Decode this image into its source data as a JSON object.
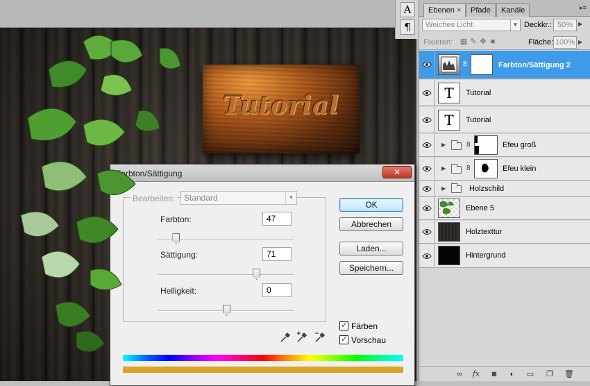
{
  "canvas": {
    "sign_text": "Tutorial"
  },
  "tool_strip": {
    "items": [
      {
        "name": "character-panel-icon",
        "glyph": "A"
      },
      {
        "name": "paragraph-panel-icon",
        "glyph": "¶"
      }
    ]
  },
  "layers_panel": {
    "tabs": [
      {
        "label": "Ebenen",
        "active": true,
        "close": "×"
      },
      {
        "label": "Pfade",
        "active": false
      },
      {
        "label": "Kanäle",
        "active": false
      }
    ],
    "menu_icon": "▸≡",
    "blend_mode": "Weiches Licht",
    "opacity_label": "Deckkr.:",
    "opacity_value": "50%",
    "lock_label": "Fixieren:",
    "fill_label": "Fläche:",
    "fill_value": "100%",
    "layers": [
      {
        "name": "Farbton/Sättigung 2",
        "selected": true,
        "type": "adjustment"
      },
      {
        "name": "Tutorial",
        "type": "text"
      },
      {
        "name": "Tutorial",
        "type": "text"
      },
      {
        "name": "Efeu groß",
        "type": "group-mask"
      },
      {
        "name": "Efeu klein",
        "type": "group-mask"
      },
      {
        "name": "Holzschild",
        "type": "group"
      },
      {
        "name": "Ebene 5",
        "type": "pixel"
      },
      {
        "name": "Holztexttur",
        "type": "pixel"
      },
      {
        "name": "Hintergrund",
        "type": "pixel"
      }
    ],
    "footer_icons": [
      "link-layers-icon",
      "fx-icon",
      "add-mask-icon",
      "adjustment-layer-icon",
      "new-group-icon",
      "new-layer-icon",
      "delete-layer-icon"
    ]
  },
  "dialog": {
    "title": "Farbton/Sättigung",
    "close_label": "✕",
    "edit_label": "Bearbeiten:",
    "edit_value": "Standard",
    "sliders": [
      {
        "label": "Farbton:",
        "value": "47",
        "position": 0.13
      },
      {
        "label": "Sättigung:",
        "value": "71",
        "position": 0.72
      },
      {
        "label": "Helligkeit:",
        "value": "0",
        "position": 0.5
      }
    ],
    "buttons": {
      "ok": "OK",
      "cancel": "Abbrechen",
      "load": "Laden...",
      "save": "Speichern..."
    },
    "checkboxes": {
      "colorize": "Färben",
      "preview": "Vorschau"
    },
    "colors": {
      "colorize_bar": "#d7a423"
    }
  }
}
